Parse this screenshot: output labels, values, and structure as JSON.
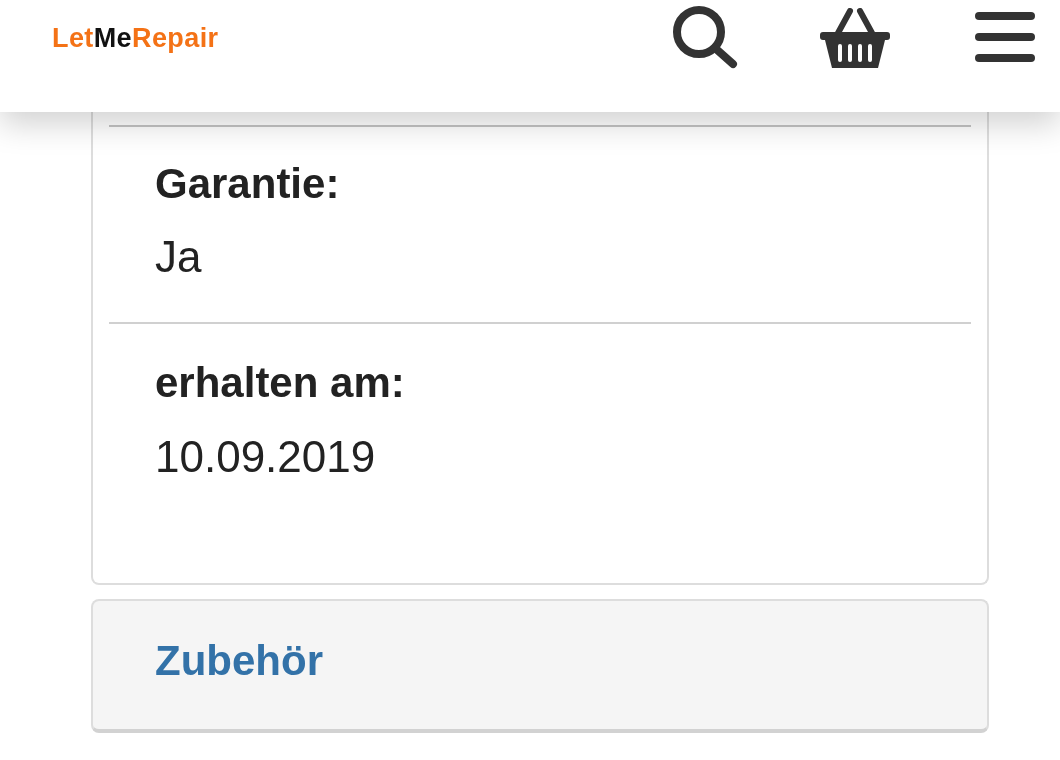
{
  "header": {
    "logo": {
      "parts": [
        {
          "text": "Let",
          "color": "#f47216"
        },
        {
          "text": "Me",
          "color": "#111111"
        },
        {
          "text": "Repair",
          "color": "#f47216"
        }
      ]
    }
  },
  "details": {
    "fields": [
      {
        "label": "Garantie:",
        "value": "Ja"
      },
      {
        "label": "erhalten am:",
        "value": "10.09.2019"
      }
    ]
  },
  "sections": [
    {
      "title": "Zubehör"
    }
  ]
}
